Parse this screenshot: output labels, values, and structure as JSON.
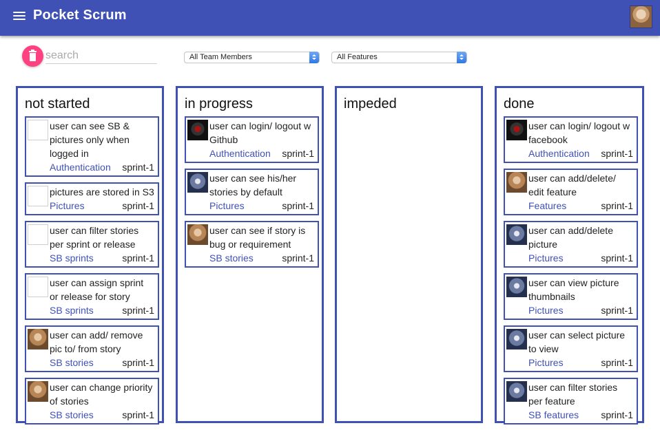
{
  "app": {
    "title": "Pocket Scrum"
  },
  "search": {
    "placeholder": "search",
    "value": ""
  },
  "filters": {
    "team_members": "All Team Members",
    "features": "All Features"
  },
  "colors": {
    "primary": "#3f51b5",
    "accent": "#ff4081"
  },
  "icons": {
    "menu": "menu-icon",
    "delete": "trash-icon",
    "select_arrows": "chevron-updown-icon"
  },
  "columns": [
    {
      "title": "not started",
      "cards": [
        {
          "text": "user can see SB & pictures only when logged in",
          "feature": "Authentication",
          "sprint": "sprint-1",
          "avatar": "blank"
        },
        {
          "text": "pictures are stored in S3",
          "feature": "Pictures",
          "sprint": "sprint-1",
          "avatar": "blank"
        },
        {
          "text": "user can filter stories per sprint or release",
          "feature": "SB sprints",
          "sprint": "sprint-1",
          "avatar": "blank"
        },
        {
          "text": "user can assign sprint or release for story",
          "feature": "SB sprints",
          "sprint": "sprint-1",
          "avatar": "blank"
        },
        {
          "text": "user can add/ remove pic to/ from story",
          "feature": "SB stories",
          "sprint": "sprint-1",
          "avatar": "woman"
        },
        {
          "text": "user can change priority of stories",
          "feature": "SB stories",
          "sprint": "sprint-1",
          "avatar": "woman"
        }
      ]
    },
    {
      "title": "in progress",
      "cards": [
        {
          "text": "user can login/ logout w Github",
          "feature": "Authentication",
          "sprint": "sprint-1",
          "avatar": "robot"
        },
        {
          "text": "user can see his/her stories by default",
          "feature": "Pictures",
          "sprint": "sprint-1",
          "avatar": "man"
        },
        {
          "text": "user can see if story is bug or requirement",
          "feature": "SB stories",
          "sprint": "sprint-1",
          "avatar": "woman"
        }
      ]
    },
    {
      "title": "impeded",
      "cards": []
    },
    {
      "title": "done",
      "cards": [
        {
          "text": "user can login/ logout w facebook",
          "feature": "Authentication",
          "sprint": "sprint-1",
          "avatar": "robot"
        },
        {
          "text": "user can add/delete/ edit feature",
          "feature": "Features",
          "sprint": "sprint-1",
          "avatar": "woman"
        },
        {
          "text": "user can add/delete picture",
          "feature": "Pictures",
          "sprint": "sprint-1",
          "avatar": "man"
        },
        {
          "text": "user can view picture thumbnails",
          "feature": "Pictures",
          "sprint": "sprint-1",
          "avatar": "man"
        },
        {
          "text": "user can select picture to view",
          "feature": "Pictures",
          "sprint": "sprint-1",
          "avatar": "man"
        },
        {
          "text": "user can filter stories per feature",
          "feature": "SB features",
          "sprint": "sprint-1",
          "avatar": "man"
        }
      ]
    }
  ]
}
